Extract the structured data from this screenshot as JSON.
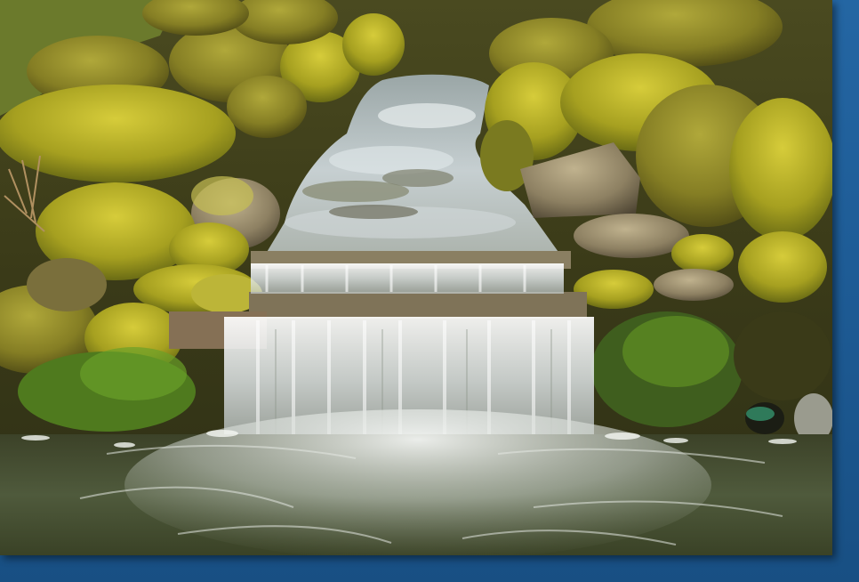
{
  "image": {
    "subject": "waterfall-cascade-over-mossy-rocks",
    "frame_color": "#1e5c96",
    "colors": {
      "moss_bright": "#b9b32a",
      "moss_dark": "#6f7418",
      "rock": "#8d8062",
      "water_light": "#e9eef0",
      "pool": "#4a5239"
    }
  }
}
